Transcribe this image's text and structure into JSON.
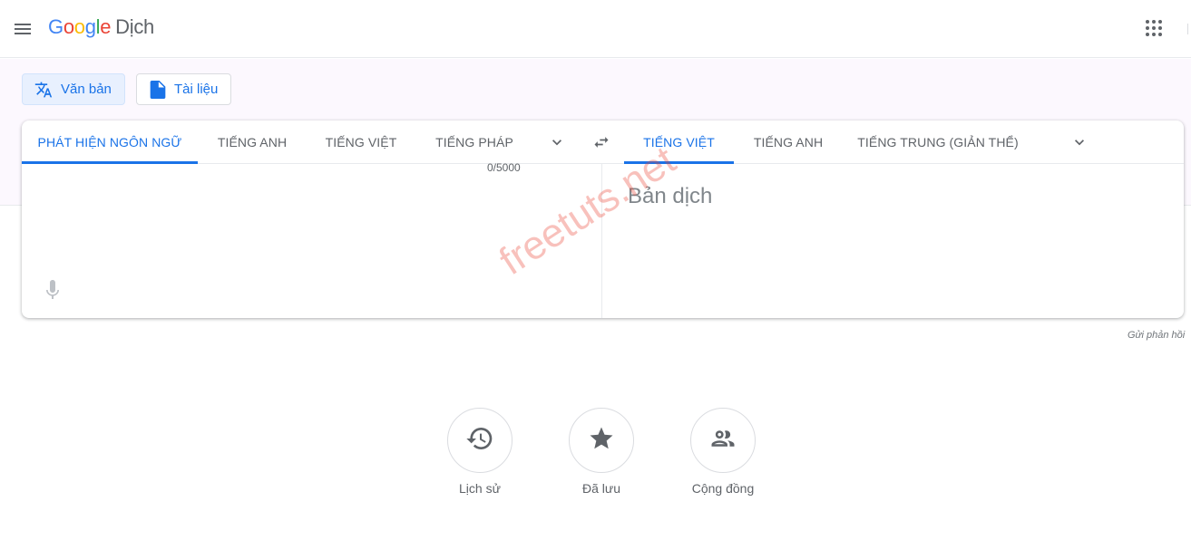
{
  "header": {
    "logo_letters": [
      "G",
      "o",
      "o",
      "g",
      "l",
      "e"
    ],
    "app_name": "Dịch"
  },
  "modes": {
    "text_label": "Văn bản",
    "document_label": "Tài liệu"
  },
  "source_languages": {
    "tabs": [
      "PHÁT HIỆN NGÔN NGỮ",
      "TIẾNG ANH",
      "TIẾNG VIỆT",
      "TIẾNG PHÁP"
    ],
    "active_index": 0
  },
  "target_languages": {
    "tabs": [
      "TIẾNG VIỆT",
      "TIẾNG ANH",
      "TIẾNG TRUNG (GIẢN THỂ)"
    ],
    "active_index": 0
  },
  "source": {
    "value": "",
    "counter": "0/5000"
  },
  "output": {
    "placeholder": "Bản dịch"
  },
  "feedback_label": "Gửi phản hồi",
  "watermark": "freetuts.net",
  "actions": [
    {
      "label": "Lịch sử",
      "icon": "history-icon"
    },
    {
      "label": "Đã lưu",
      "icon": "star-icon"
    },
    {
      "label": "Cộng đồng",
      "icon": "community-icon"
    }
  ],
  "colors": {
    "accent": "#1a73e8",
    "band_background": "#fcf8fe",
    "text_muted": "#5f6368"
  }
}
